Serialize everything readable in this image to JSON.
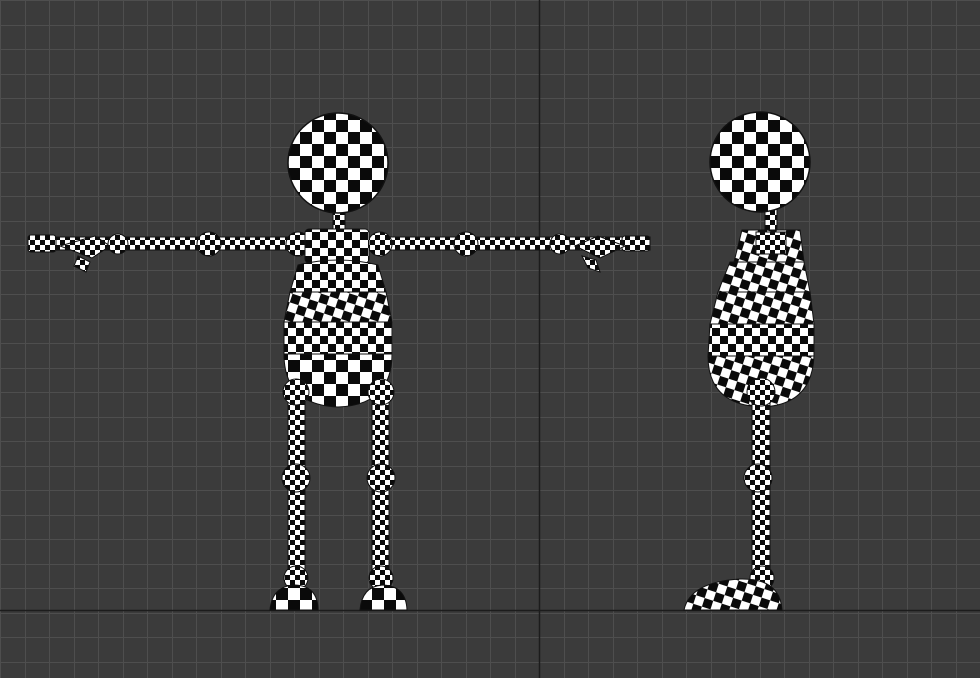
{
  "viewport": {
    "background_color": "#3b3b3b",
    "grid_color": "#4e4e4e",
    "axis_color": "#1c1c1c",
    "checker_dark": "#0a0a0a",
    "checker_light": "#ffffff"
  },
  "models": [
    {
      "view": "front",
      "icon": "checker-textured-character"
    },
    {
      "view": "side",
      "icon": "checker-textured-character"
    }
  ]
}
